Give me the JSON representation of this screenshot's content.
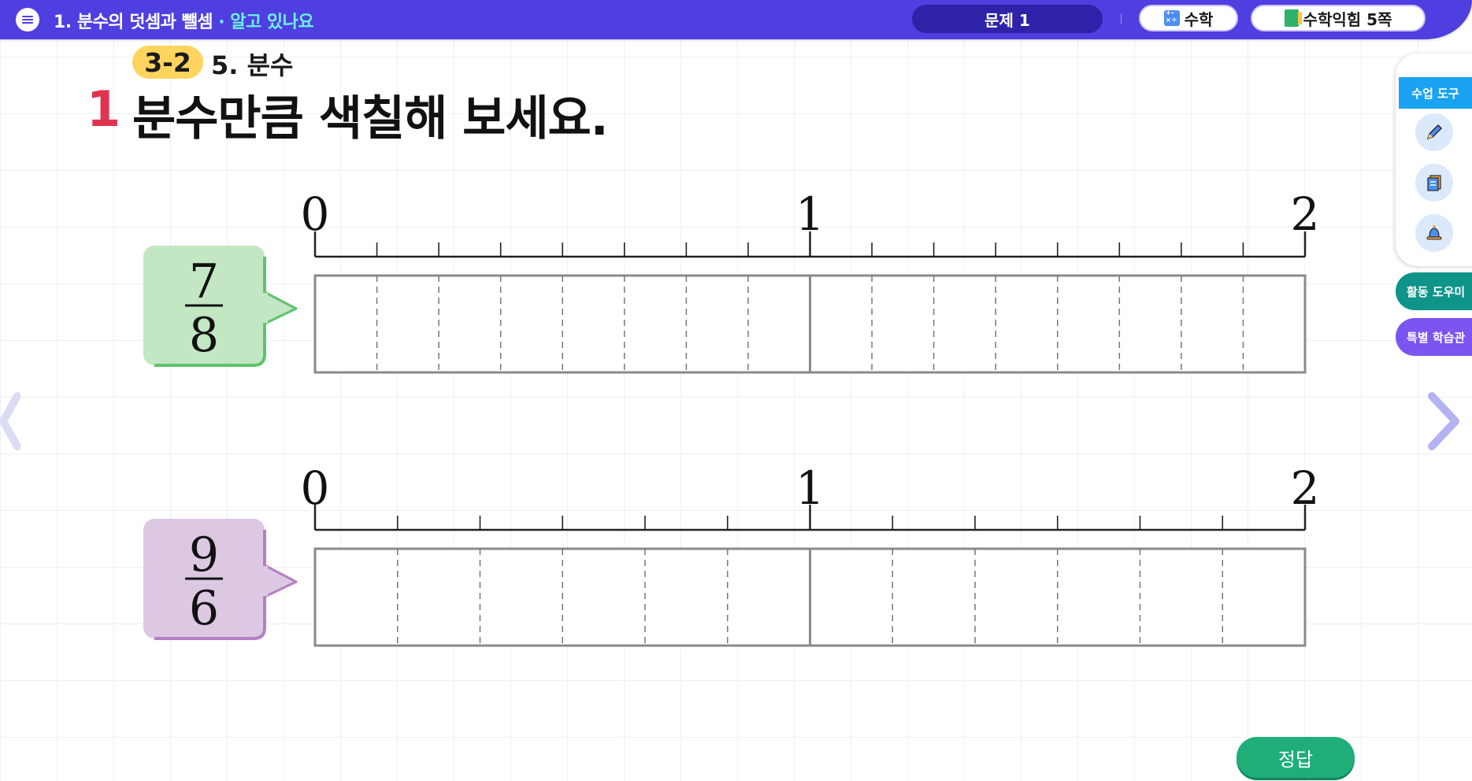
{
  "header": {
    "lesson_title": "1. 분수의 덧셈과 뺄셈",
    "lesson_sub": " · 알고 있나요",
    "problem_label": "문제 1",
    "subject_label": "수학",
    "book_label": "수학익힘 5쪽"
  },
  "content": {
    "grade": "3-2",
    "unit": "5. 분수",
    "question_number": "1",
    "question_text": "분수만큼 색칠해 보세요."
  },
  "problems": [
    {
      "numerator": "7",
      "denominator": "8",
      "ticks": [
        "0",
        "1",
        "2"
      ],
      "parts_per_unit": 8,
      "card_color": "#c3e6c3",
      "card_border": "#5cc46b"
    },
    {
      "numerator": "9",
      "denominator": "6",
      "ticks": [
        "0",
        "1",
        "2"
      ],
      "parts_per_unit": 6,
      "card_color": "#dcc8e3",
      "card_border": "#b57fc4"
    }
  ],
  "sidebar": {
    "tools_label": "수업 도구",
    "tools": [
      "pencil-icon",
      "document-icon",
      "bell-icon"
    ],
    "activity_label": "활동 도우미",
    "special_label": "특별 학습관"
  },
  "footer": {
    "answer_label": "정답"
  }
}
